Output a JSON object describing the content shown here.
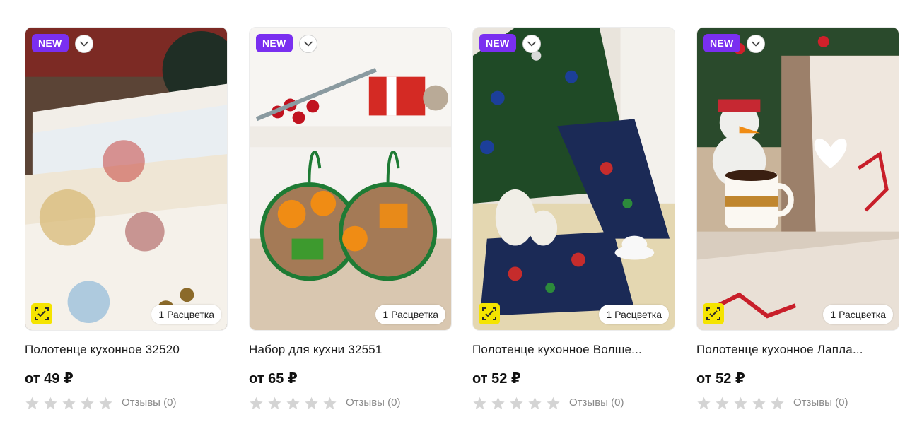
{
  "products": [
    {
      "badge": "NEW",
      "variants": "1 Расцветка",
      "title": "Полотенце кухонное 32520",
      "price": "от 49 ₽",
      "rating_stars": 0,
      "reviews": "Отзывы (0)",
      "has_scan_icon": true
    },
    {
      "badge": "NEW",
      "variants": "1 Расцветка",
      "title": "Набор для кухни 32551",
      "price": "от 65 ₽",
      "rating_stars": 0,
      "reviews": "Отзывы (0)",
      "has_scan_icon": false
    },
    {
      "badge": "NEW",
      "variants": "1 Расцветка",
      "title": "Полотенце кухонное Волше...",
      "price": "от 52 ₽",
      "rating_stars": 0,
      "reviews": "Отзывы (0)",
      "has_scan_icon": true
    },
    {
      "badge": "NEW",
      "variants": "1 Расцветка",
      "title": "Полотенце кухонное Лапла...",
      "price": "от 52 ₽",
      "rating_stars": 0,
      "reviews": "Отзывы (0)",
      "has_scan_icon": true
    }
  ],
  "colors": {
    "badge": "#7a2ff0",
    "star_empty": "#d4d4d4",
    "scan_icon_bg": "#f5e400"
  }
}
